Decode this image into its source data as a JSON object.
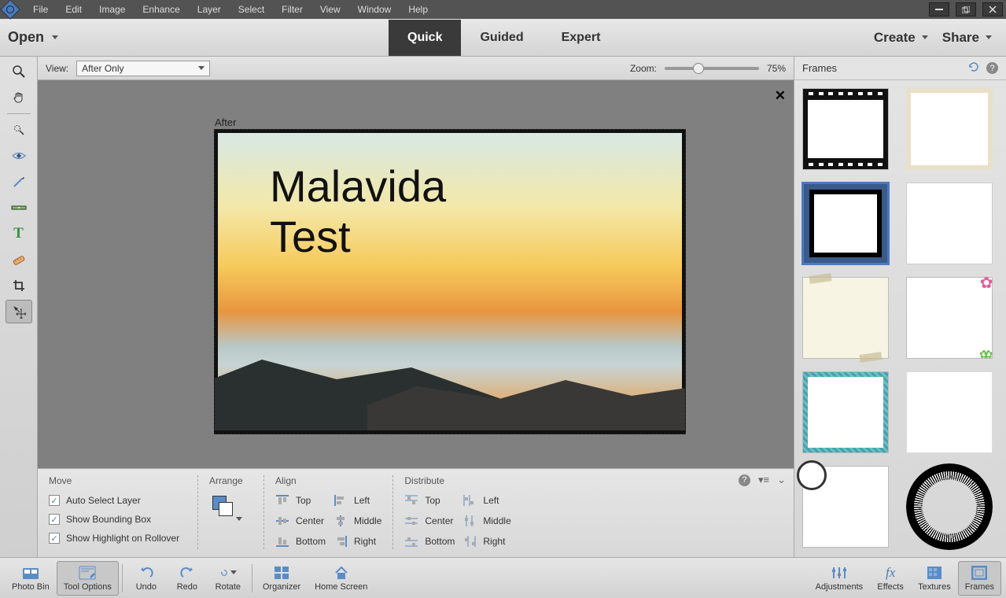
{
  "menu": {
    "items": [
      "File",
      "Edit",
      "Image",
      "Enhance",
      "Layer",
      "Select",
      "Filter",
      "View",
      "Window",
      "Help"
    ]
  },
  "modebar": {
    "open": "Open",
    "tabs": [
      "Quick",
      "Guided",
      "Expert"
    ],
    "active": "Quick",
    "create": "Create",
    "share": "Share"
  },
  "viewbar": {
    "view_label": "View:",
    "view_value": "After Only",
    "zoom_label": "Zoom:",
    "zoom_value": "75%"
  },
  "canvas": {
    "after_label": "After",
    "text": "Malavida\nTest"
  },
  "options": {
    "move_title": "Move",
    "checks": [
      "Auto Select Layer",
      "Show Bounding Box",
      "Show Highlight on Rollover"
    ],
    "arrange_title": "Arrange",
    "align_title": "Align",
    "distribute_title": "Distribute",
    "col1": [
      "Top",
      "Center",
      "Bottom"
    ],
    "col2": [
      "Left",
      "Middle",
      "Right"
    ]
  },
  "frames_panel": {
    "title": "Frames"
  },
  "bottombar": {
    "left": [
      "Photo Bin",
      "Tool Options",
      "Undo",
      "Redo",
      "Rotate",
      "Organizer",
      "Home Screen"
    ],
    "right": [
      "Adjustments",
      "Effects",
      "Textures",
      "Frames"
    ],
    "active_left": "Tool Options",
    "active_right": "Frames"
  }
}
